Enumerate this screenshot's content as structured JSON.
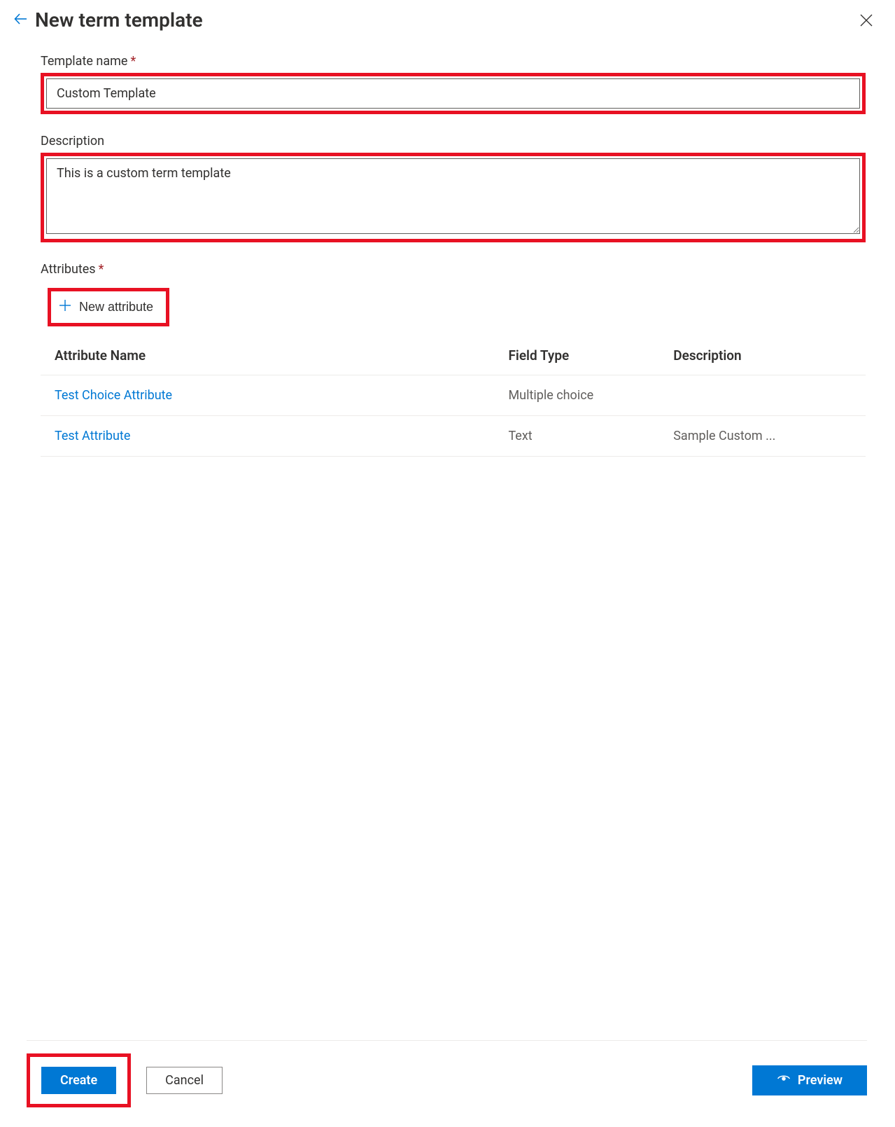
{
  "header": {
    "title": "New term template"
  },
  "fields": {
    "template_name": {
      "label": "Template name",
      "value": "Custom Template"
    },
    "description": {
      "label": "Description",
      "value": "This is a custom term template"
    },
    "attributes": {
      "label": "Attributes",
      "new_button": "New attribute",
      "columns": {
        "name": "Attribute Name",
        "type": "Field Type",
        "desc": "Description"
      },
      "rows": [
        {
          "name": "Test Choice Attribute",
          "type": "Multiple choice",
          "desc": ""
        },
        {
          "name": "Test Attribute",
          "type": "Text",
          "desc": "Sample Custom ..."
        }
      ]
    }
  },
  "footer": {
    "create": "Create",
    "cancel": "Cancel",
    "preview": "Preview"
  }
}
